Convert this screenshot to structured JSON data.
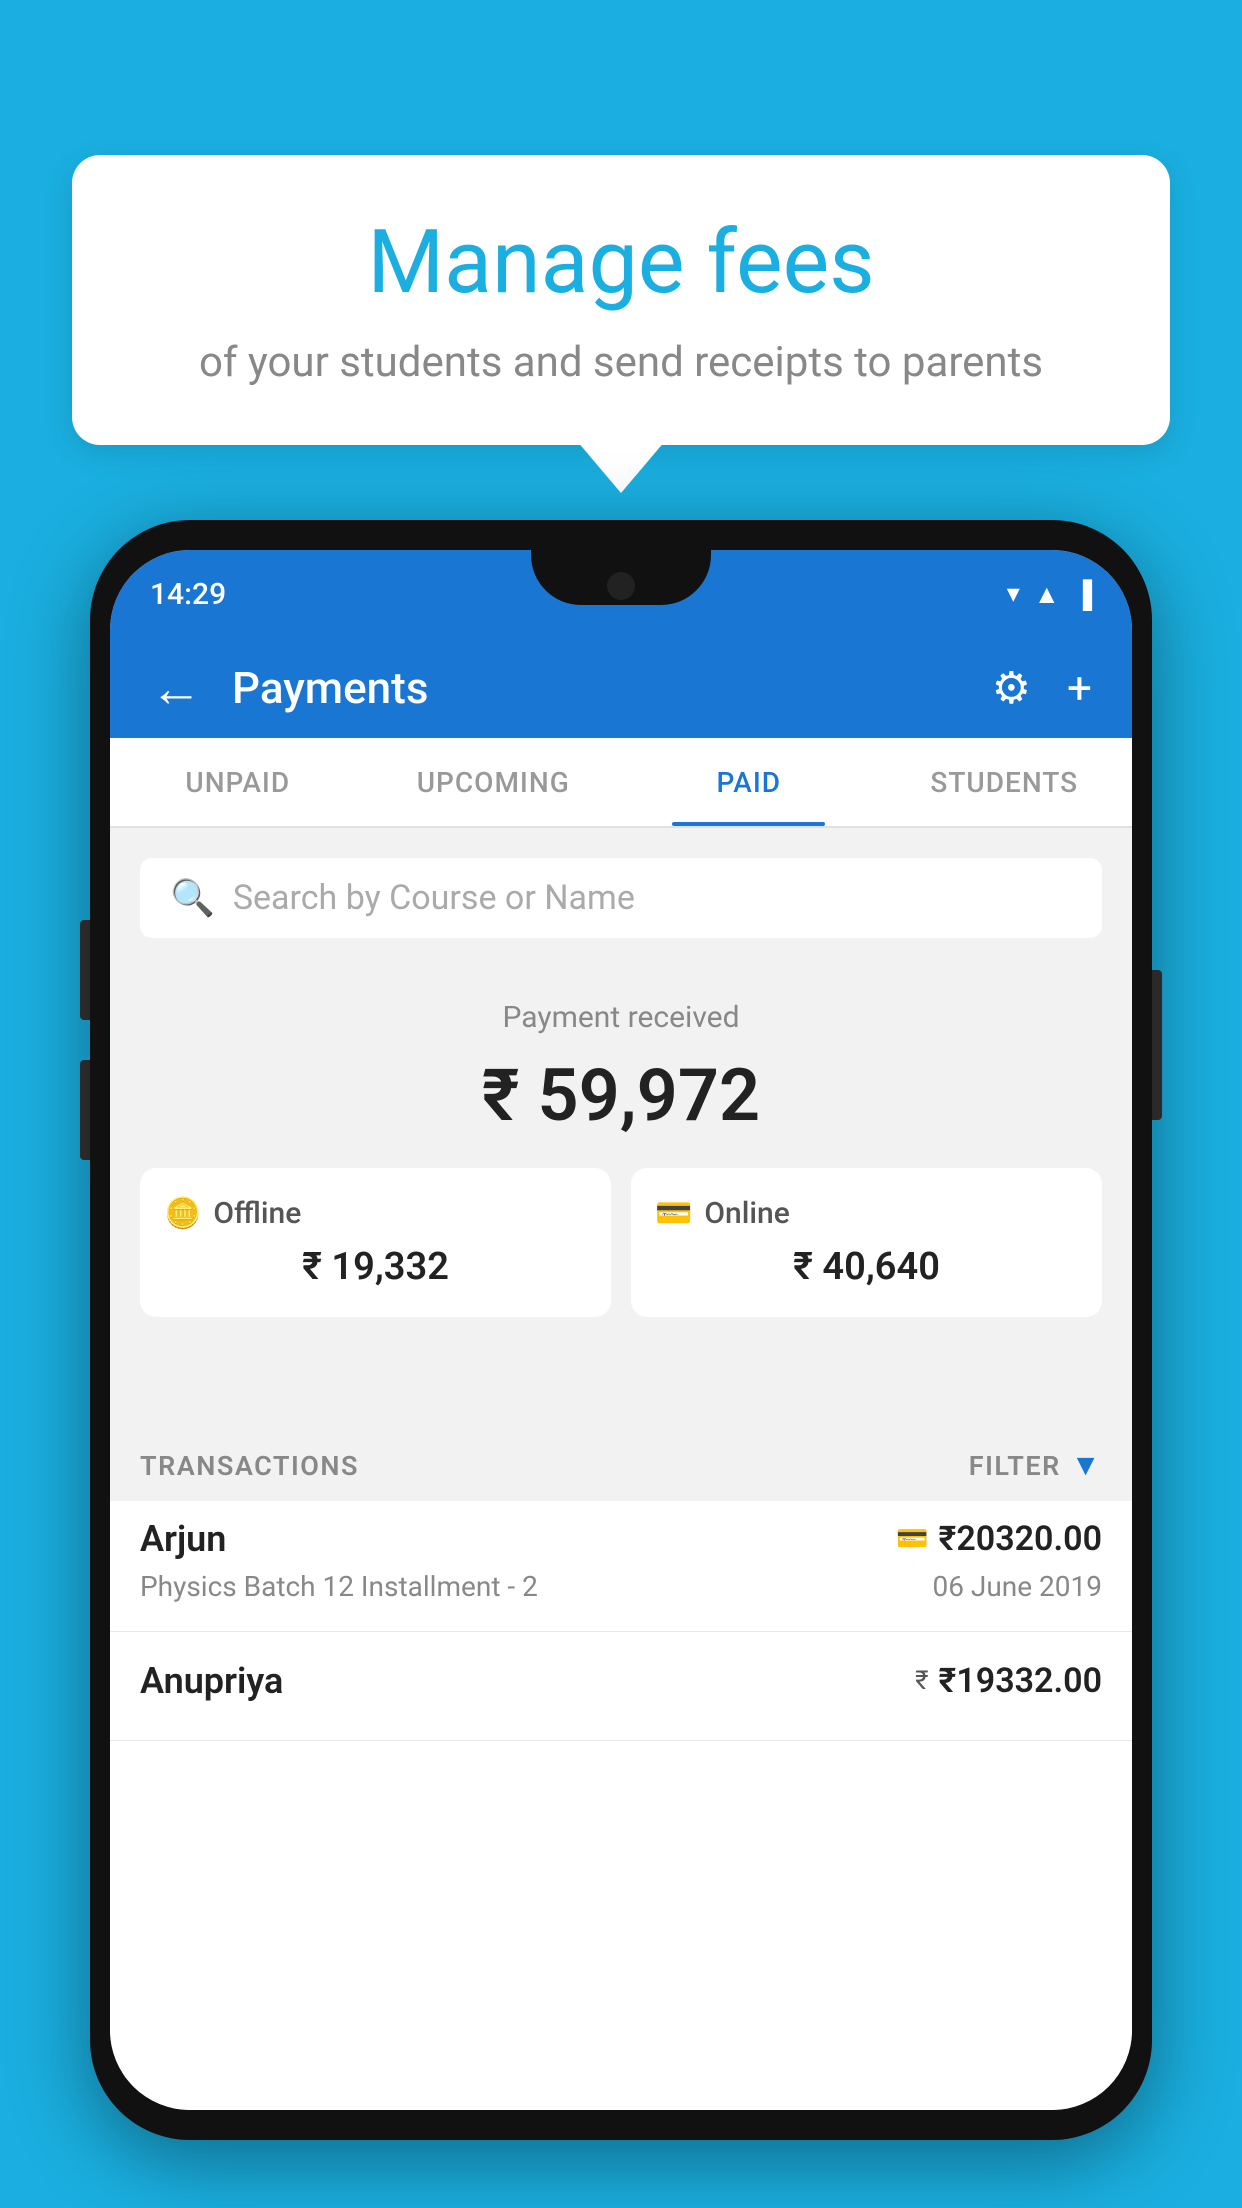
{
  "background_color": "#1AAFE0",
  "bubble": {
    "title": "Manage fees",
    "subtitle": "of your students and send receipts to parents"
  },
  "phone": {
    "status_time": "14:29",
    "header": {
      "title": "Payments",
      "back_label": "←",
      "settings_label": "⚙",
      "add_label": "+"
    },
    "tabs": [
      {
        "label": "UNPAID",
        "active": false
      },
      {
        "label": "UPCOMING",
        "active": false
      },
      {
        "label": "PAID",
        "active": true
      },
      {
        "label": "STUDENTS",
        "active": false
      }
    ],
    "search": {
      "placeholder": "Search by Course or Name"
    },
    "payment_received": {
      "label": "Payment received",
      "amount": "₹ 59,972",
      "offline": {
        "type": "Offline",
        "amount": "₹ 19,332"
      },
      "online": {
        "type": "Online",
        "amount": "₹ 40,640"
      }
    },
    "transactions": {
      "label": "TRANSACTIONS",
      "filter_label": "FILTER",
      "items": [
        {
          "name": "Arjun",
          "course": "Physics Batch 12 Installment - 2",
          "amount": "₹20320.00",
          "date": "06 June 2019",
          "payment_type": "card"
        },
        {
          "name": "Anupriya",
          "course": "",
          "amount": "₹19332.00",
          "date": "",
          "payment_type": "rupee"
        }
      ]
    }
  }
}
